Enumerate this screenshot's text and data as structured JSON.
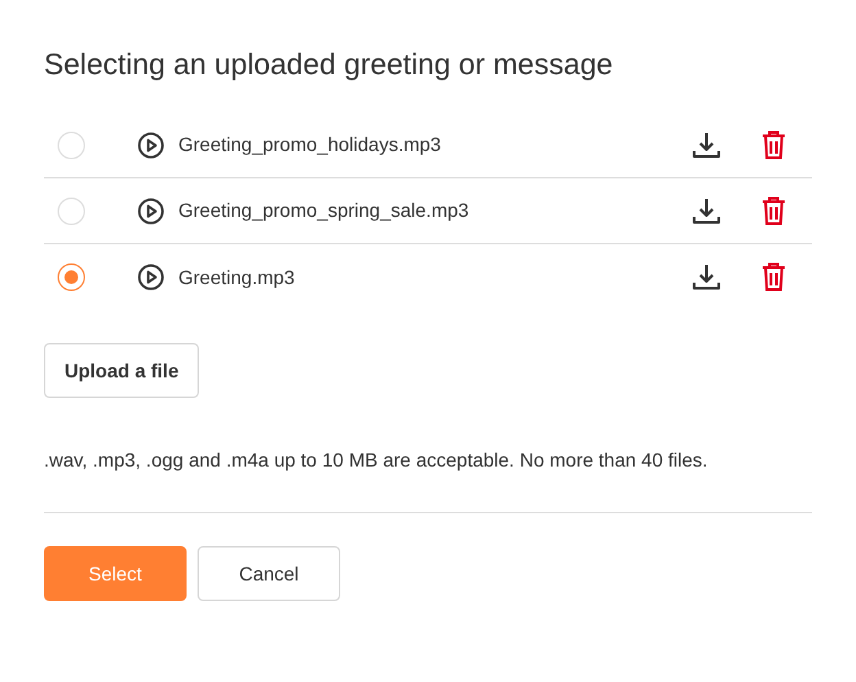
{
  "title": "Selecting an uploaded greeting or message",
  "files": [
    {
      "name": "Greeting_promo_holidays.mp3",
      "selected": false
    },
    {
      "name": "Greeting_promo_spring_sale.mp3",
      "selected": false
    },
    {
      "name": "Greeting.mp3",
      "selected": true
    }
  ],
  "upload_button": "Upload a file",
  "note": ".wav, .mp3, .ogg and .m4a up to 10 MB are acceptable. No more than 40 files.",
  "buttons": [
    {
      "label": "Select",
      "kind": "primary"
    },
    {
      "label": "Cancel",
      "kind": "secondary"
    }
  ]
}
